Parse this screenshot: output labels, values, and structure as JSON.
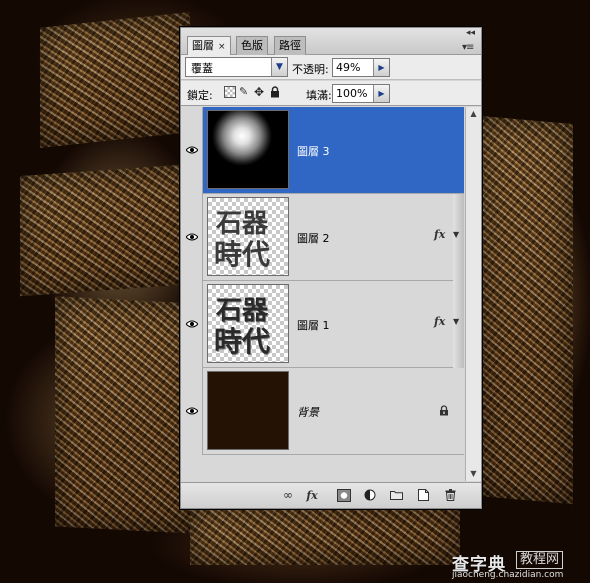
{
  "panel": {
    "tabs": [
      {
        "label": "圖層",
        "close": "×"
      },
      {
        "label": "色版"
      },
      {
        "label": "路徑"
      }
    ],
    "collapse_glyph": "◂◂",
    "menu_glyph": "▾≡",
    "blend_mode": "覆蓋",
    "opacity_label": "不透明:",
    "opacity_value": "49%",
    "lock_label": "鎖定:",
    "fill_label": "填滿:",
    "fill_value": "100%"
  },
  "layers": [
    {
      "name": "圖層 3",
      "selected": true,
      "thumbnail": "white-radial-glow-on-black",
      "fx": false
    },
    {
      "name": "圖層 2",
      "selected": false,
      "thumbnail": "石器時代-text-on-transparent",
      "fx": true,
      "fx_label": "fx"
    },
    {
      "name": "圖層 1",
      "selected": false,
      "thumbnail": "石器時代-text-blurred-on-transparent",
      "fx": true,
      "fx_label": "fx"
    },
    {
      "name": "背景",
      "selected": false,
      "thumbnail": "dark-brown-fill",
      "locked": true
    }
  ],
  "thumb_text": {
    "top": "石器",
    "bottom": "時代"
  },
  "bottom_toolbar": {
    "fx_label": "fx"
  },
  "watermark": {
    "main": "查字典",
    "boxed": "教程网",
    "url": "jiaocheng.chazidian.com"
  },
  "colors": {
    "selection": "#3066c4",
    "panel_bg": "#d8d8d8",
    "artwork_bg": "#140803"
  }
}
